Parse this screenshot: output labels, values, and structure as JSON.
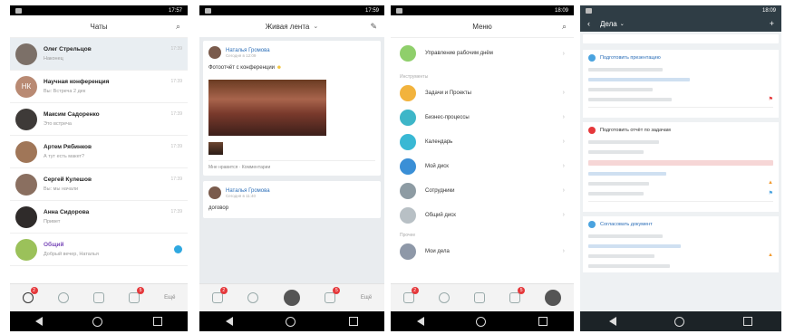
{
  "status": {
    "time1": "17:57",
    "time2": "17:59",
    "time3": "18:09"
  },
  "chats": {
    "title": "Чаты",
    "items": [
      {
        "name": "Олег Стрельцов",
        "msg": "Наконец",
        "time": "17:39",
        "initials": "",
        "color": "#7c7068",
        "selected": true
      },
      {
        "name": "Научная конференция",
        "msg": "Вы: Встреча 2 дек",
        "time": "17:39",
        "initials": "НК",
        "color": "#b98a73",
        "selected": false
      },
      {
        "name": "Максим Садоренко",
        "msg": "Это встреча",
        "time": "17:39",
        "initials": "",
        "color": "#3e3a38",
        "selected": false
      },
      {
        "name": "Артем Рябинков",
        "msg": "А тут есть макет?",
        "time": "17:39",
        "initials": "",
        "color": "#a07658",
        "selected": false
      },
      {
        "name": "Сергей Кулешов",
        "msg": "Вы: мы начали",
        "time": "17:39",
        "initials": "",
        "color": "#8a6f60",
        "selected": false
      },
      {
        "name": "Анна Сидорова",
        "msg": "Привет",
        "time": "17:39",
        "initials": "",
        "color": "#2f2b2a",
        "selected": false
      },
      {
        "name": "Общий",
        "msg": "Добрый вечер, Наталья",
        "time": "",
        "initials": "",
        "color": "#9bc15a",
        "selected": false
      }
    ]
  },
  "feed": {
    "title": "Живая лента",
    "post1": {
      "author": "Наталья Громова",
      "meta": "Сегодня в 12:09",
      "text": "Фотоотчёт с конференции",
      "footer": "Мне нравится · Комментарии"
    },
    "post2": {
      "author": "Наталья Громова",
      "meta": "Сегодня в 11:40",
      "text": "договор"
    }
  },
  "menu": {
    "title": "Меню",
    "top": {
      "label": "Управление рабочим днём",
      "color": "#8fcf6b"
    },
    "section1": "Инструменты",
    "items": [
      {
        "label": "Задачи и Проекты",
        "color": "#f2b33d"
      },
      {
        "label": "Бизнес-процессы",
        "color": "#3eb6c8"
      },
      {
        "label": "Календарь",
        "color": "#39b8d4"
      },
      {
        "label": "Мой диск",
        "color": "#3a8fd6"
      },
      {
        "label": "Сотрудники",
        "color": "#8d9ba3"
      },
      {
        "label": "Общий диск",
        "color": "#b8c0c5"
      }
    ],
    "section2": "Прочее",
    "bottom": {
      "label": "Мои дела",
      "color": "#8e98a8"
    }
  },
  "tasks": {
    "title": "Дела",
    "cards": [
      {
        "title": "Подготовить презентацию",
        "dot": "#4aa3df",
        "flag": "red"
      },
      {
        "title": "Подготовить отчёт по задачам",
        "dot": "#e5383b",
        "flag": "blue"
      },
      {
        "title": "Согласовать документ",
        "dot": "#4aa3df",
        "flag": "none"
      }
    ]
  },
  "tabbar": {
    "badge1": "2",
    "badge2": "5",
    "more": "Ещё"
  }
}
